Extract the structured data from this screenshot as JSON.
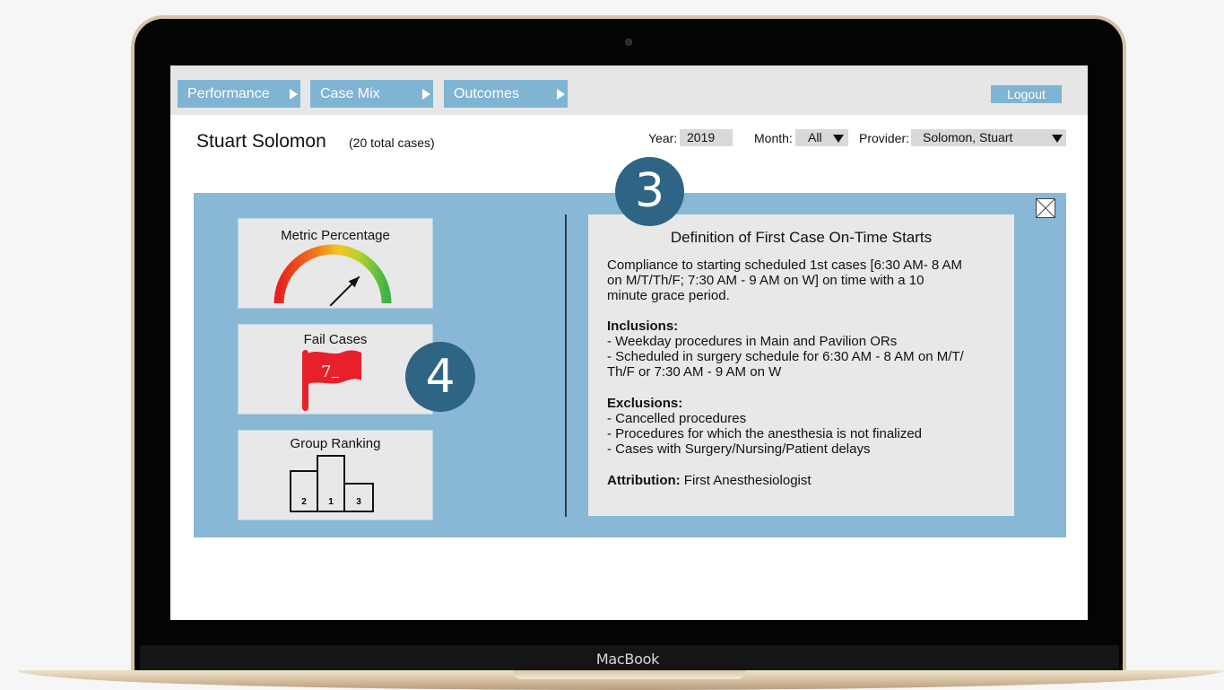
{
  "device": {
    "brand": "MacBook"
  },
  "nav": {
    "tabs": [
      {
        "label": "Performance"
      },
      {
        "label": "Case Mix"
      },
      {
        "label": "Outcomes"
      }
    ],
    "logout_label": "Logout"
  },
  "header": {
    "name": "Stuart Solomon",
    "total_cases": "(20 total cases)"
  },
  "filters": {
    "year_label": "Year:",
    "year_value": "2019",
    "month_label": "Month:",
    "month_value": "All",
    "provider_label": "Provider:",
    "provider_value": "Solomon, Stuart"
  },
  "cards": {
    "metric_title": "Metric Percentage",
    "metric_gauge_level": 0.75,
    "fail_title": "Fail Cases",
    "fail_count": "7",
    "ranking_title": "Group Ranking",
    "podium": [
      "2",
      "1",
      "3"
    ]
  },
  "definition": {
    "title": "Definition of First Case On-Time Starts",
    "intro": [
      "Compliance to starting scheduled 1st cases [6:30 AM- 8 AM",
      "on M/T/Th/F; 7:30 AM - 9 AM on W] on time with a 10",
      "minute grace period."
    ],
    "inclusions_heading": "Inclusions:",
    "inclusions": [
      "- Weekday procedures in Main and Pavilion ORs",
      "- Scheduled in surgery schedule for 6:30 AM - 8 AM on M/T/",
      "Th/F or 7:30 AM - 9 AM on W"
    ],
    "exclusions_heading": "Exclusions:",
    "exclusions": [
      "- Cancelled procedures",
      "- Procedures for which the anesthesia is not finalized",
      "- Cases with Surgery/Nursing/Patient delays"
    ],
    "attribution_heading": "Attribution:",
    "attribution_value": " First Anesthesiologist"
  },
  "markers": {
    "step_three": "3",
    "step_four": "4"
  },
  "colors": {
    "nav_blue": "#7fb4d2",
    "panel_blue": "#88b8d5",
    "marker_blue": "#2e6585",
    "flag_red": "#e8202a"
  }
}
